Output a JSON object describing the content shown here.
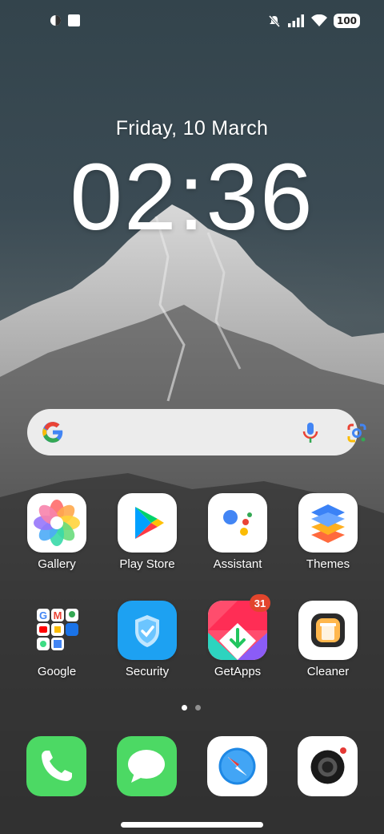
{
  "status_bar": {
    "battery": "100",
    "icons": [
      "vpn-icon",
      "square-icon",
      "mute-icon",
      "signal-icon",
      "wifi-icon",
      "battery-icon"
    ]
  },
  "lock": {
    "date": "Friday, 10 March",
    "time": "02:36"
  },
  "search": {
    "icons": [
      "google-g-icon",
      "mic-icon",
      "google-lens-icon"
    ]
  },
  "apps": {
    "row1": [
      {
        "label": "Gallery",
        "icon": "gallery-icon"
      },
      {
        "label": "Play Store",
        "icon": "play-store-icon"
      },
      {
        "label": "Assistant",
        "icon": "assistant-icon"
      },
      {
        "label": "Themes",
        "icon": "themes-icon"
      }
    ],
    "row2": [
      {
        "label": "Google",
        "icon": "google-folder-icon"
      },
      {
        "label": "Security",
        "icon": "security-icon"
      },
      {
        "label": "GetApps",
        "icon": "getapps-icon",
        "badge": "31"
      },
      {
        "label": "Cleaner",
        "icon": "cleaner-icon"
      }
    ]
  },
  "dock": [
    "phone-icon",
    "messages-icon",
    "browser-icon",
    "camera-icon"
  ],
  "page_indicator": {
    "pages": 2,
    "active": 1
  },
  "colors": {
    "phone": "#4cd964",
    "messages": "#4cd964",
    "security": "#1da1f2",
    "badge": "#e2452c"
  }
}
